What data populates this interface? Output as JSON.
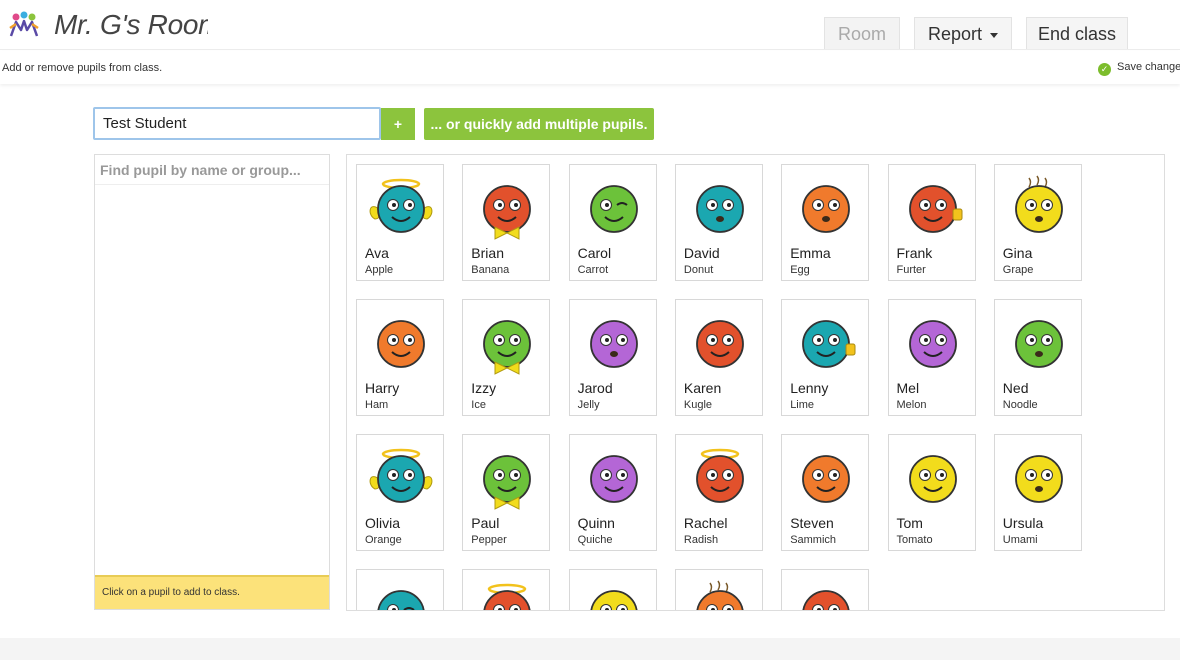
{
  "header": {
    "title": "Mr. G's Room",
    "nav": {
      "room": "Room",
      "report": "Report",
      "end_class": "End class"
    }
  },
  "subheader": {
    "instruction": "Add or remove pupils from class.",
    "save_status": "Save changes"
  },
  "add_pupil": {
    "name_value": "Test Student",
    "plus_label": "+",
    "multi_label": "... or quickly add multiple pupils."
  },
  "search": {
    "placeholder": "Find pupil by name or group...",
    "hint": "Click on a pupil to add to class."
  },
  "colors": {
    "accent_green": "#8cc43d",
    "hint_yellow": "#fce27a",
    "input_focus": "#9ec5ea"
  },
  "pupils": [
    {
      "first": "Ava",
      "last": "Apple",
      "color": "#1ba7b0",
      "face": "angel-winged-icon"
    },
    {
      "first": "Brian",
      "last": "Banana",
      "color": "#e2512c",
      "face": "bowtie-icon"
    },
    {
      "first": "Carol",
      "last": "Carrot",
      "color": "#6cc23a",
      "face": "wink-icon"
    },
    {
      "first": "David",
      "last": "Donut",
      "color": "#1ba7b0",
      "face": "shocked-icon"
    },
    {
      "first": "Emma",
      "last": "Egg",
      "color": "#f07a2c",
      "face": "shocked-icon"
    },
    {
      "first": "Frank",
      "last": "Furter",
      "color": "#e2512c",
      "face": "thumbs-up-icon"
    },
    {
      "first": "Gina",
      "last": "Grape",
      "color": "#f2dc1c",
      "face": "frazzled-icon"
    },
    {
      "first": "Harry",
      "last": "Ham",
      "color": "#f07a2c",
      "face": "smile-icon"
    },
    {
      "first": "Izzy",
      "last": "Ice",
      "color": "#6cc23a",
      "face": "bowtie-icon"
    },
    {
      "first": "Jarod",
      "last": "Jelly",
      "color": "#b466d6",
      "face": "shocked-icon"
    },
    {
      "first": "Karen",
      "last": "Kugle",
      "color": "#e2512c",
      "face": "happy-icon"
    },
    {
      "first": "Lenny",
      "last": "Lime",
      "color": "#1ba7b0",
      "face": "thumbs-up-icon"
    },
    {
      "first": "Mel",
      "last": "Melon",
      "color": "#b466d6",
      "face": "smile-icon"
    },
    {
      "first": "Ned",
      "last": "Noodle",
      "color": "#6cc23a",
      "face": "shocked-icon"
    },
    {
      "first": "Olivia",
      "last": "Orange",
      "color": "#1ba7b0",
      "face": "angel-winged-icon"
    },
    {
      "first": "Paul",
      "last": "Pepper",
      "color": "#6cc23a",
      "face": "bowtie-icon"
    },
    {
      "first": "Quinn",
      "last": "Quiche",
      "color": "#b466d6",
      "face": "smile-icon"
    },
    {
      "first": "Rachel",
      "last": "Radish",
      "color": "#e2512c",
      "face": "halo-icon"
    },
    {
      "first": "Steven",
      "last": "Sammich",
      "color": "#f07a2c",
      "face": "smile-icon"
    },
    {
      "first": "Tom",
      "last": "Tomato",
      "color": "#f2dc1c",
      "face": "smile-icon"
    },
    {
      "first": "Ursula",
      "last": "Umami",
      "color": "#f2dc1c",
      "face": "shocked-icon"
    },
    {
      "first": "",
      "last": "",
      "color": "#1ba7b0",
      "face": "wink-icon"
    },
    {
      "first": "",
      "last": "",
      "color": "#e2512c",
      "face": "halo-icon"
    },
    {
      "first": "",
      "last": "",
      "color": "#f2dc1c",
      "face": "smile-icon"
    },
    {
      "first": "",
      "last": "",
      "color": "#f07a2c",
      "face": "frazzled-icon"
    },
    {
      "first": "",
      "last": "",
      "color": "#e2512c",
      "face": "smile-icon"
    }
  ]
}
